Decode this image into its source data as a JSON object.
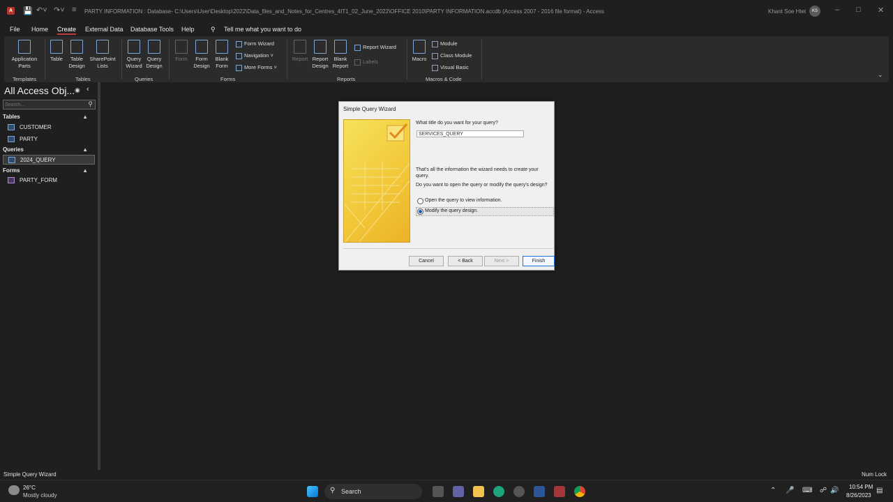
{
  "window": {
    "title": "PARTY INFORMATION : Database- C:\\Users\\User\\Desktop\\2022\\Data_files_and_Notes_for_Centres_4IT1_02_June_2022\\OFFICE 2010\\PARTY INFORMATION.accdb (Access 2007 - 2016 file format)  -  Access",
    "user_name": "Khant Soe Htet",
    "user_initials": "KS"
  },
  "menu": {
    "file": "File",
    "home": "Home",
    "create": "Create",
    "external": "External Data",
    "dbtools": "Database Tools",
    "help": "Help",
    "tell": "Tell me what you want to do"
  },
  "ribbon": {
    "app_parts": "Application Parts",
    "table": "Table",
    "table_design": "Table Design",
    "sharepoint": "SharePoint Lists",
    "query_wizard": "Query Wizard",
    "query_design": "Query Design",
    "form": "Form",
    "form_design": "Form Design",
    "blank_form": "Blank Form",
    "form_wizard": "Form Wizard",
    "navigation": "Navigation",
    "more_forms": "More Forms",
    "report": "Report",
    "report_design": "Report Design",
    "blank_report": "Blank Report",
    "report_wizard": "Report Wizard",
    "labels": "Labels",
    "macro": "Macro",
    "module": "Module",
    "class_module": "Class Module",
    "visual_basic": "Visual Basic",
    "groups": {
      "templates": "Templates",
      "tables": "Tables",
      "queries": "Queries",
      "forms": "Forms",
      "reports": "Reports",
      "macros": "Macros & Code"
    }
  },
  "nav": {
    "title": "All Access Obj...",
    "search_placeholder": "Search...",
    "tables_header": "Tables",
    "queries_header": "Queries",
    "forms_header": "Forms",
    "tables": [
      "CUSTOMER",
      "PARTY"
    ],
    "queries": [
      "2024_QUERY"
    ],
    "forms": [
      "PARTY_FORM"
    ]
  },
  "dialog": {
    "title": "Simple Query Wizard",
    "question": "What title do you want for your query?",
    "query_title": "SERVICES_QUERY",
    "info": "That's all the information the wizard needs to create your query.",
    "prompt": "Do you want to open the query or modify the query's design?",
    "option_open": "Open the query to view information.",
    "option_modify": "Modify the query design.",
    "cancel": "Cancel",
    "back": "< Back",
    "next": "Next >",
    "finish": "Finish"
  },
  "status": {
    "left": "Simple Query Wizard",
    "right": "Num Lock"
  },
  "taskbar": {
    "weather_temp": "26°C",
    "weather_desc": "Mostly cloudy",
    "search": "Search",
    "time": "10:54 PM",
    "date": "8/26/2023"
  }
}
